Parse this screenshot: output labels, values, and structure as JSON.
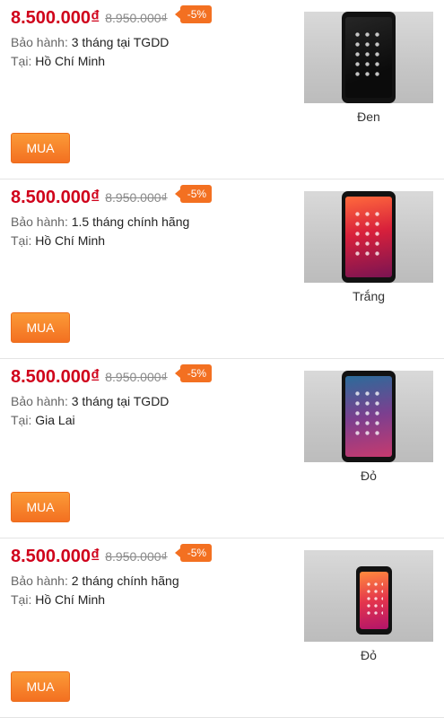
{
  "listings": [
    {
      "price": "8.500.000₫",
      "old_price": "8.950.000₫",
      "discount": "-5%",
      "warranty_label": "Bảo hành:",
      "warranty_value": "3 tháng tại TGDD",
      "location_label": "Tại:",
      "location_value": "Hồ Chí Minh",
      "color": "Đen",
      "buy_label": "MUA"
    },
    {
      "price": "8.500.000₫",
      "old_price": "8.950.000₫",
      "discount": "-5%",
      "warranty_label": "Bảo hành:",
      "warranty_value": "1.5 tháng chính hãng",
      "location_label": "Tại:",
      "location_value": "Hồ Chí Minh",
      "color": "Trắng",
      "buy_label": "MUA"
    },
    {
      "price": "8.500.000₫",
      "old_price": "8.950.000₫",
      "discount": "-5%",
      "warranty_label": "Bảo hành:",
      "warranty_value": "3 tháng tại TGDD",
      "location_label": "Tại:",
      "location_value": "Gia Lai",
      "color": "Đỏ",
      "buy_label": "MUA"
    },
    {
      "price": "8.500.000₫",
      "old_price": "8.950.000₫",
      "discount": "-5%",
      "warranty_label": "Bảo hành:",
      "warranty_value": "2 tháng chính hãng",
      "location_label": "Tại:",
      "location_value": "Hồ Chí Minh",
      "color": "Đỏ",
      "buy_label": "MUA"
    }
  ],
  "colors": {
    "price": "#d0021b",
    "discount_badge": "#f37021",
    "buy_button": "#f37021"
  }
}
